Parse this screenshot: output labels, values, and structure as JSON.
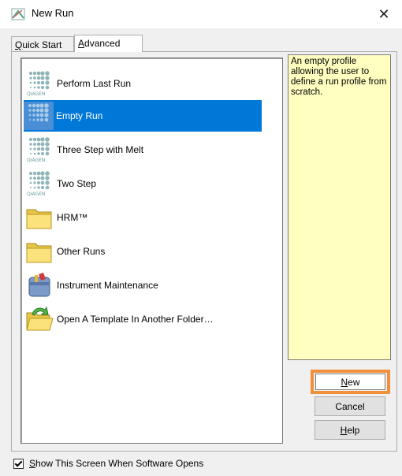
{
  "window": {
    "title": "New Run",
    "close_glyph": "✕"
  },
  "tabs": [
    {
      "label": "Quick Start",
      "mnemonic": "Q",
      "rest": "uick Start",
      "active": false
    },
    {
      "label": "Advanced",
      "mnemonic": "A",
      "rest": "dvanced",
      "active": true
    }
  ],
  "items": [
    {
      "label": "Perform Last Run",
      "icon": "qiagen-logo-icon",
      "selected": false
    },
    {
      "label": "Empty Run",
      "icon": "qiagen-logo-icon",
      "selected": true
    },
    {
      "label": "Three Step with Melt",
      "icon": "qiagen-logo-icon",
      "selected": false
    },
    {
      "label": "Two Step",
      "icon": "qiagen-logo-icon",
      "selected": false
    },
    {
      "label": "HRM™",
      "icon": "folder-icon",
      "selected": false
    },
    {
      "label": "Other Runs",
      "icon": "folder-icon",
      "selected": false
    },
    {
      "label": "Instrument Maintenance",
      "icon": "toolbox-icon",
      "selected": false
    },
    {
      "label": "Open A Template In Another Folder…",
      "icon": "open-folder-icon",
      "selected": false
    }
  ],
  "description": "An empty profile allowing the user to define a run profile from scratch.",
  "buttons": {
    "new": {
      "label": "New",
      "mnemonic": "N",
      "rest": "ew"
    },
    "cancel": {
      "label": "Cancel"
    },
    "help": {
      "label": "Help",
      "mnemonic": "H",
      "rest": "elp"
    }
  },
  "footer": {
    "checkbox_checked": true,
    "label_mnemonic": "S",
    "label_rest": "how This Screen When Software Opens"
  },
  "colors": {
    "selection": "#0078d7",
    "description_bg": "#ffffc0",
    "highlight_border": "#f0903a"
  }
}
